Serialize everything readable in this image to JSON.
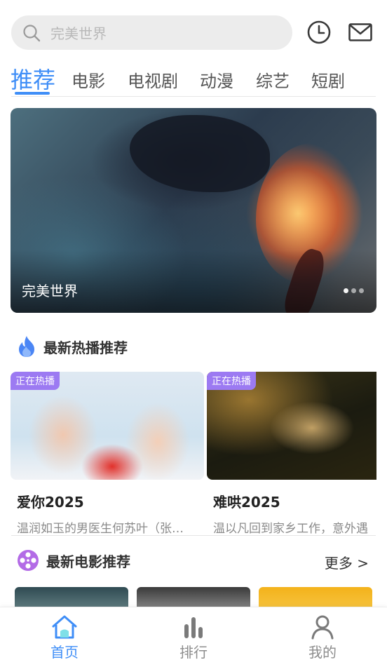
{
  "header": {
    "search_placeholder": "完美世界",
    "history_icon": "clock-icon",
    "message_icon": "mail-icon"
  },
  "tabs": [
    {
      "label": "推荐",
      "active": true
    },
    {
      "label": "电影"
    },
    {
      "label": "电视剧"
    },
    {
      "label": "动漫"
    },
    {
      "label": "综艺"
    },
    {
      "label": "短剧"
    }
  ],
  "banner": {
    "title": "完美世界",
    "slides": 3,
    "active_slide": 1
  },
  "hot_section": {
    "title": "最新热播推荐",
    "icon": "flame-icon",
    "items": [
      {
        "tag": "正在热播",
        "name": "爱你2025",
        "desc": "温润如玉的男医生何苏叶（张…"
      },
      {
        "tag": "正在热播",
        "name": "难哄2025",
        "desc": "温以凡回到家乡工作，意外遇"
      }
    ]
  },
  "movie_section": {
    "title": "最新电影推荐",
    "icon": "film-reel-icon",
    "more_label": "更多 >"
  },
  "bottom_nav": [
    {
      "label": "首页",
      "icon": "home-icon",
      "active": true
    },
    {
      "label": "排行",
      "icon": "bar-chart-icon"
    },
    {
      "label": "我的",
      "icon": "user-icon"
    }
  ],
  "colors": {
    "accent": "#3f8ef7",
    "tag_bg": "#9c7af2",
    "flame": "#4b86f5",
    "reel": "#b36be6"
  }
}
